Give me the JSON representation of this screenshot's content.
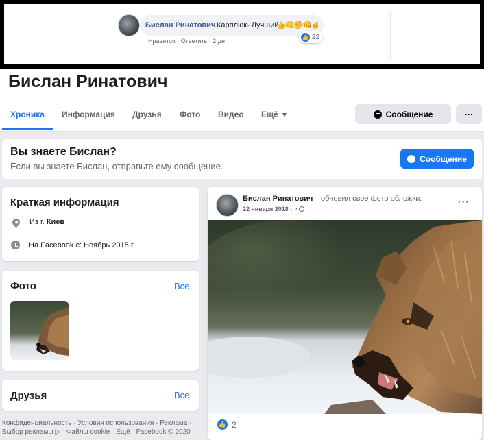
{
  "comment": {
    "author": "Бислан Ринатович",
    "text": "Карплюк- Лучший",
    "emoji": "👍👊✊👊☝",
    "like_action": "Нравится",
    "reply_action": "Ответить",
    "time": "2 дн.",
    "reaction_count": "22",
    "reaction_icon": "like-icon"
  },
  "profile": {
    "name": "Бислан Ринатович"
  },
  "nav": {
    "tabs": [
      "Хроника",
      "Информация",
      "Друзья",
      "Фото",
      "Видео",
      "Ещё"
    ],
    "active_tab": "Хроника",
    "message_button": "Сообщение",
    "more_button": "···"
  },
  "know": {
    "title": "Вы знаете Бислан?",
    "subtitle": "Если вы знаете Бислан, отправьте ему сообщение.",
    "button": "Сообщение"
  },
  "intro": {
    "title": "Краткая информация",
    "from_prefix": "Из г.",
    "from_city": "Киев",
    "joined": "На Facebook с: Ноябрь 2015 г."
  },
  "photos": {
    "title": "Фото",
    "see_all": "Все"
  },
  "friends": {
    "title": "Друзья",
    "see_all": "Все"
  },
  "footer": {
    "line1": "Конфиденциальность · Условия использования · Реклама ·",
    "line2": "Выбор рекламы ▷ · Файлы cookie · Ещё · Facebook © 2020"
  },
  "post": {
    "author": "Бислан Ринатович",
    "action": "обновил свое фото обложки.",
    "date": "22 января 2018 г. ·",
    "more": "···",
    "reaction_count": "2"
  },
  "colors": {
    "accent": "#1877f2",
    "background": "#e9ebee",
    "link": "#385898"
  }
}
